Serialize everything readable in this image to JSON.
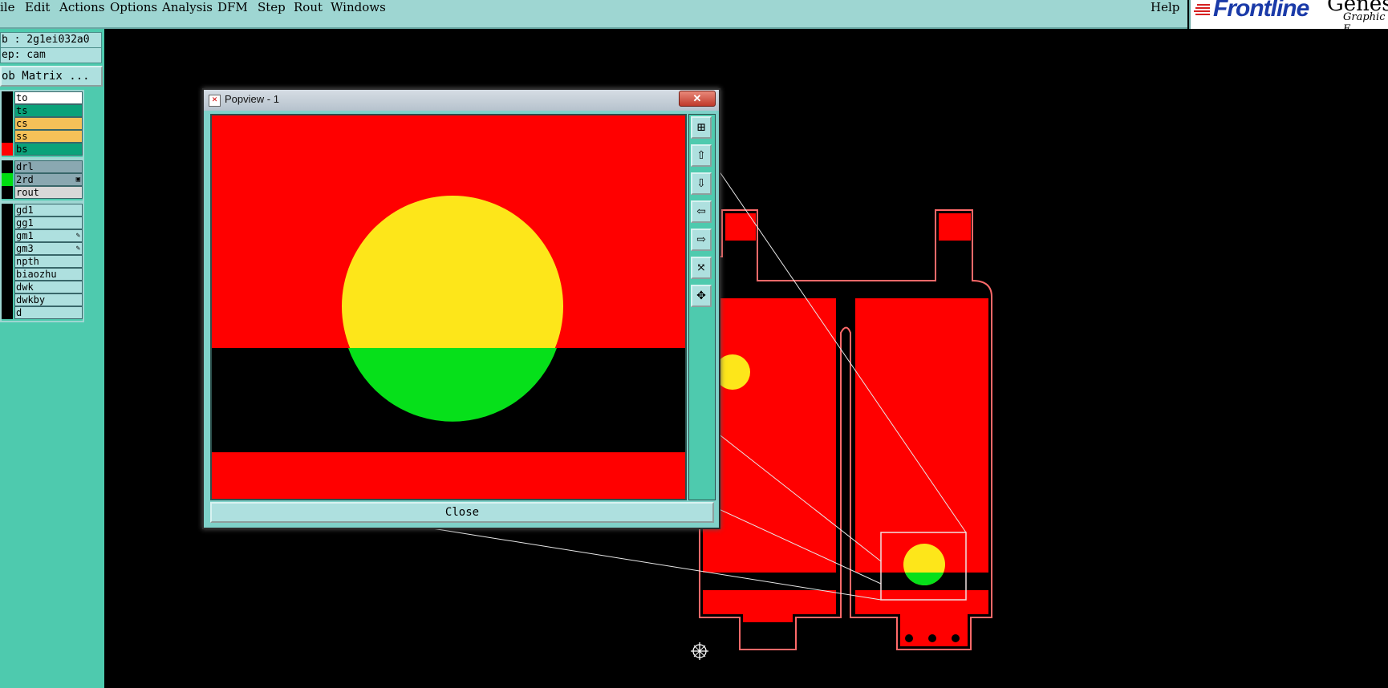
{
  "menubar": {
    "items": [
      "ile",
      "Edit",
      "Actions",
      "Options",
      "Analysis",
      "DFM",
      "Step",
      "Rout",
      "Windows"
    ],
    "help": "Help"
  },
  "brand": {
    "logo_text": "Frontline",
    "product_text": "Genesis",
    "subtitle": "Graphic E"
  },
  "sidebar": {
    "job_label": "b : 2g1ei032a0",
    "step_label": "ep: cam",
    "matrix_button": "ob Matrix ..."
  },
  "layers": {
    "board": [
      {
        "name": "to",
        "swatch": "#000000",
        "bg": "#ffffff"
      },
      {
        "name": "ts",
        "swatch": "#000000",
        "bg": "#0aa27a"
      },
      {
        "name": "cs",
        "swatch": "#000000",
        "bg": "#f5c158"
      },
      {
        "name": "ss",
        "swatch": "#000000",
        "bg": "#f5c158"
      },
      {
        "name": "bs",
        "swatch": "#ff0000",
        "bg": "#0aa27a"
      }
    ],
    "drill": [
      {
        "name": "drl",
        "swatch": "#000000",
        "bg": "#8aa8b1"
      },
      {
        "name": "2rd",
        "swatch": "#00dd11",
        "bg": "#8aa8b1",
        "mark": "▣"
      },
      {
        "name": "rout",
        "swatch": "#000000",
        "bg": "#d8d8d8"
      }
    ],
    "misc": [
      {
        "name": "gd1",
        "swatch": "#000000",
        "bg": "#aee0df"
      },
      {
        "name": "gg1",
        "swatch": "#000000",
        "bg": "#aee0df"
      },
      {
        "name": "gm1",
        "swatch": "#000000",
        "bg": "#aee0df",
        "mark": "✎"
      },
      {
        "name": "gm3",
        "swatch": "#000000",
        "bg": "#aee0df",
        "mark": "✎"
      },
      {
        "name": "npth",
        "swatch": "#000000",
        "bg": "#aee0df"
      },
      {
        "name": "biaozhu",
        "swatch": "#000000",
        "bg": "#aee0df"
      },
      {
        "name": "dwk",
        "swatch": "#000000",
        "bg": "#aee0df"
      },
      {
        "name": "dwkby",
        "swatch": "#000000",
        "bg": "#aee0df"
      },
      {
        "name": "d",
        "swatch": "#000000",
        "bg": "#aee0df"
      }
    ]
  },
  "popview": {
    "title": "Popview - 1",
    "close_x": "✕",
    "close_button": "Close",
    "tool_icons": [
      "zoom-window-icon",
      "pan-up-icon",
      "pan-down-icon",
      "pan-left-icon",
      "pan-right-icon",
      "zoom-fit-icon",
      "center-icon"
    ]
  },
  "colors": {
    "copper": "#ff0000",
    "pad_top": "#fde61a",
    "pad_bottom": "#06e01a",
    "ui_panel": "#9ed6d2",
    "sidebar": "#4ecaae"
  }
}
